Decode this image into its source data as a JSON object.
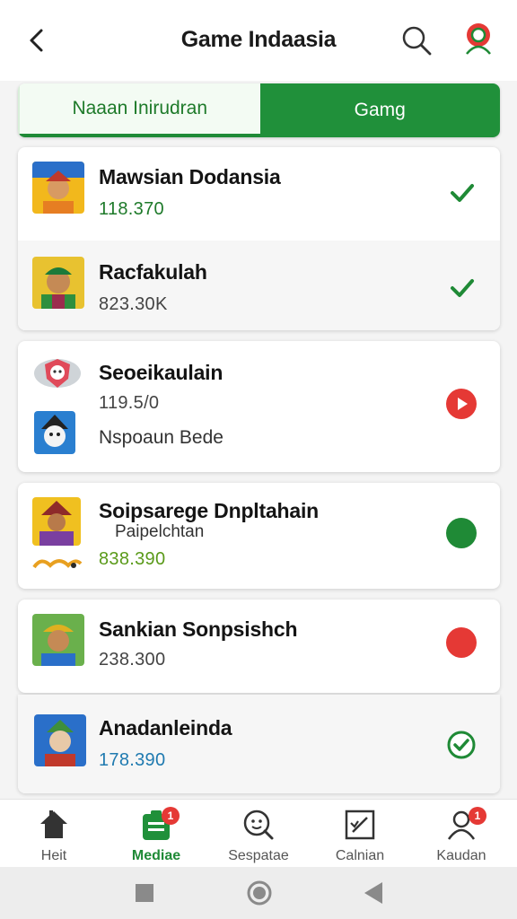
{
  "header": {
    "title": "Game Indaasia"
  },
  "tabs": [
    {
      "label": "Naaan Inirudran",
      "active": false
    },
    {
      "label": "Gamg",
      "active": true
    }
  ],
  "cards": [
    {
      "rows": [
        {
          "name": "Mawsian Dodansia",
          "count": "118.370",
          "status": "checkmark"
        },
        {
          "name": "Racfakulah",
          "count": "823.30K",
          "status": "checkmark"
        }
      ]
    },
    {
      "rows": [
        {
          "name": "Seoeikaulain",
          "count": "119.5/0",
          "status": "play-button"
        },
        {
          "name": "Nspoaun Bede"
        }
      ]
    },
    {
      "rows": [
        {
          "name": "Soipsarege Dnpltahain",
          "subtitle": "Paipelchtan",
          "count": "838.390",
          "status": "green-dot"
        }
      ]
    },
    {
      "rows": [
        {
          "name": "Sankian Sonpsishch",
          "count": "238.300",
          "status": "red-dot"
        }
      ]
    },
    {
      "rows": [
        {
          "name": "Anadanleinda",
          "count": "178.390",
          "status": "verified-check"
        }
      ]
    }
  ],
  "bottom_nav": [
    {
      "label": "Heit",
      "icon": "home-icon",
      "active": false
    },
    {
      "label": "Mediae",
      "icon": "clipboard-icon",
      "active": true,
      "badge": "1"
    },
    {
      "label": "Sespatae",
      "icon": "search-face-icon",
      "active": false
    },
    {
      "label": "Calnian",
      "icon": "edit-box-icon",
      "active": false
    },
    {
      "label": "Kaudan",
      "icon": "user-icon",
      "active": false,
      "badge": "1"
    }
  ],
  "colors": {
    "brand_green": "#20903a",
    "check_green": "#1f8a36",
    "red": "#e53935"
  }
}
